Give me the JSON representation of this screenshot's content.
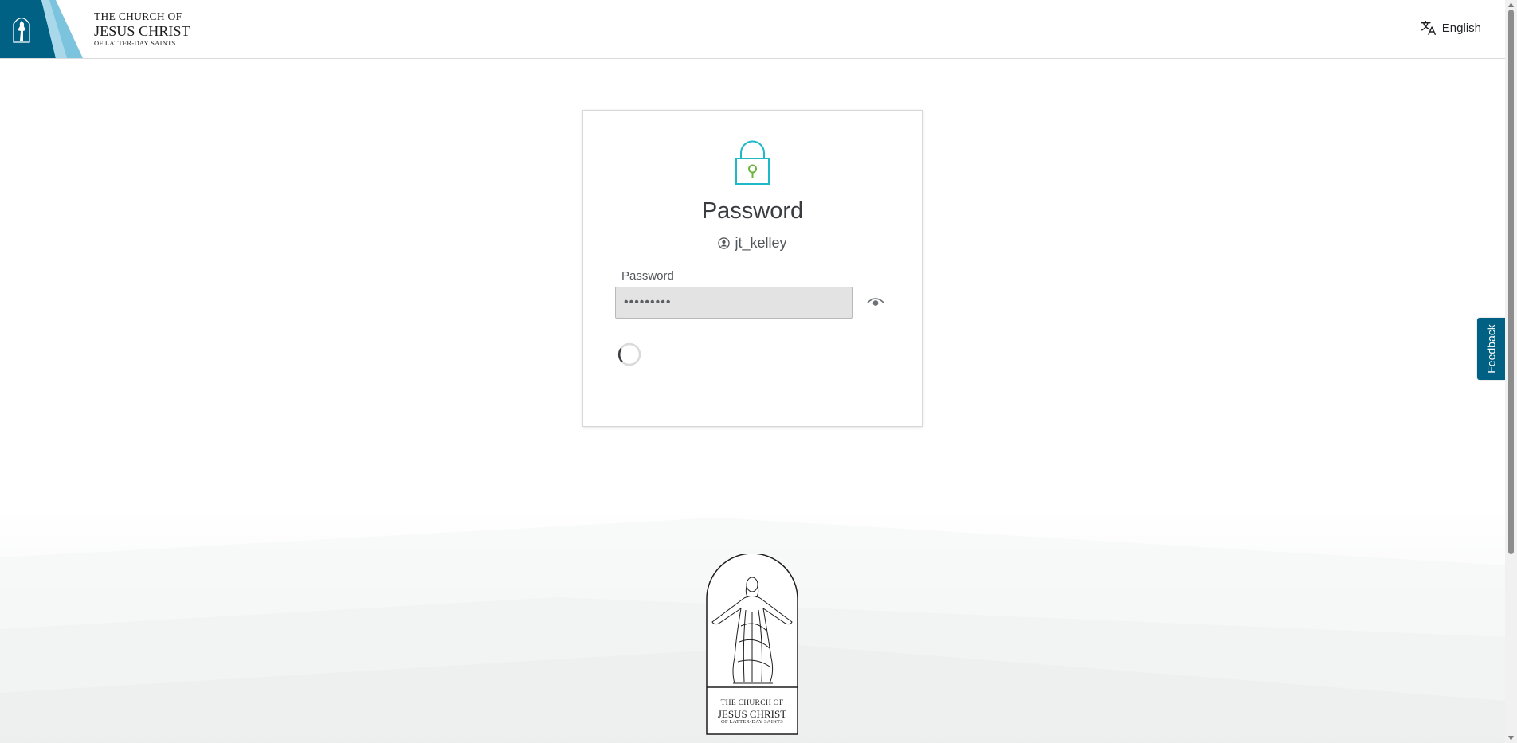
{
  "header": {
    "logo": {
      "line1": "THE CHURCH OF",
      "line2": "JESUS CHRIST",
      "line3": "OF LATTER-DAY SAINTS"
    },
    "language_label": "English"
  },
  "card": {
    "title": "Password",
    "username": "jt_kelley",
    "password_label": "Password",
    "password_value": "•••••••••"
  },
  "feedback_label": "Feedback",
  "footer_seal": {
    "line1": "THE CHURCH OF",
    "line2": "JESUS CHRIST",
    "line3": "OF LATTER-DAY SAINTS"
  },
  "colors": {
    "brand_blue": "#006184",
    "lock_teal": "#1fb8c9",
    "lock_green": "#6ab43e"
  }
}
